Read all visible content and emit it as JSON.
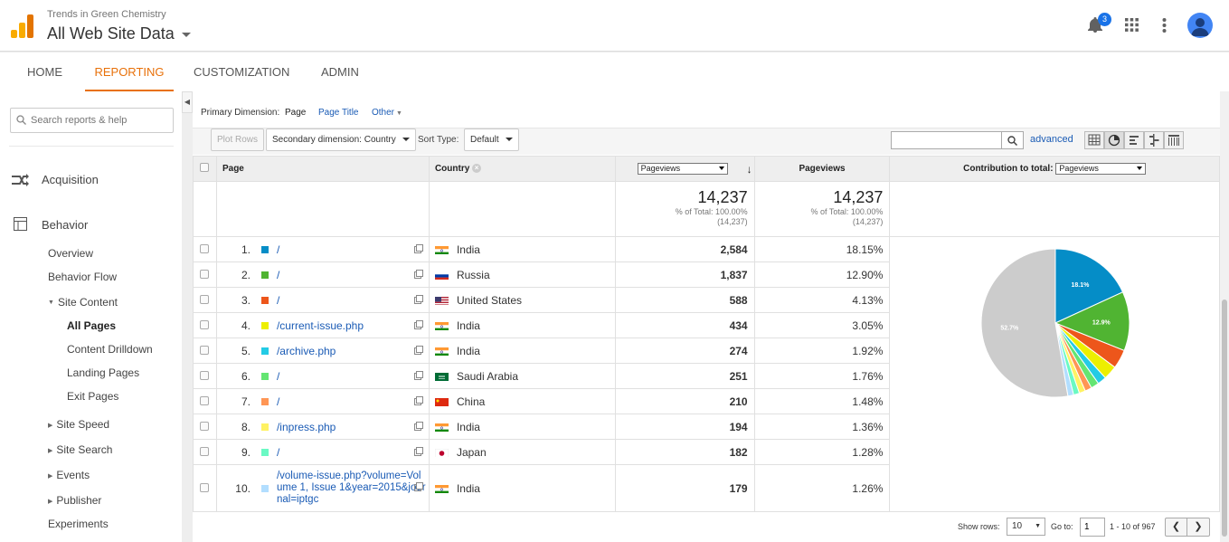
{
  "header": {
    "account_name": "Trends in Green Chemistry",
    "property_name": "All Web Site Data",
    "notification_count": "3"
  },
  "nav": {
    "tabs": [
      "HOME",
      "REPORTING",
      "CUSTOMIZATION",
      "ADMIN"
    ],
    "active_tab": "REPORTING"
  },
  "sidebar": {
    "search_placeholder": "Search reports & help",
    "acquisition": "Acquisition",
    "behavior": "Behavior",
    "overview": "Overview",
    "behavior_flow": "Behavior Flow",
    "site_content": "Site Content",
    "all_pages": "All Pages",
    "content_drilldown": "Content Drilldown",
    "landing_pages": "Landing Pages",
    "exit_pages": "Exit Pages",
    "site_speed": "Site Speed",
    "site_search": "Site Search",
    "events": "Events",
    "publisher": "Publisher",
    "experiments": "Experiments"
  },
  "dimension_bar": {
    "label": "Primary Dimension:",
    "page": "Page",
    "page_title": "Page Title",
    "other": "Other"
  },
  "toolbar": {
    "plot_rows": "Plot Rows",
    "secondary_dimension": "Secondary dimension: Country",
    "sort_type_label": "Sort Type:",
    "sort_type_value": "Default",
    "advanced": "advanced"
  },
  "table": {
    "columns": {
      "page": "Page",
      "country": "Country",
      "metric_select": "Pageviews",
      "pageviews": "Pageviews",
      "contribution_label": "Contribution to total:",
      "contribution_select": "Pageviews"
    },
    "totals": {
      "value1": "14,237",
      "pct1": "% of Total: 100.00%",
      "abs1": "(14,237)",
      "value2": "14,237",
      "pct2": "% of Total: 100.00%",
      "abs2": "(14,237)"
    },
    "rows": [
      {
        "index": "1.",
        "page": "/",
        "country": "India",
        "pageviews": "2,584",
        "percent": "18.15%",
        "color": "#058dc7",
        "flag": "in"
      },
      {
        "index": "2.",
        "page": "/",
        "country": "Russia",
        "pageviews": "1,837",
        "percent": "12.90%",
        "color": "#50b432",
        "flag": "ru"
      },
      {
        "index": "3.",
        "page": "/",
        "country": "United States",
        "pageviews": "588",
        "percent": "4.13%",
        "color": "#ed561b",
        "flag": "us"
      },
      {
        "index": "4.",
        "page": "/current-issue.php",
        "country": "India",
        "pageviews": "434",
        "percent": "3.05%",
        "color": "#edef00",
        "flag": "in"
      },
      {
        "index": "5.",
        "page": "/archive.php",
        "country": "India",
        "pageviews": "274",
        "percent": "1.92%",
        "color": "#24cbe5",
        "flag": "in"
      },
      {
        "index": "6.",
        "page": "/",
        "country": "Saudi Arabia",
        "pageviews": "251",
        "percent": "1.76%",
        "color": "#64e572",
        "flag": "sa"
      },
      {
        "index": "7.",
        "page": "/",
        "country": "China",
        "pageviews": "210",
        "percent": "1.48%",
        "color": "#ff9655",
        "flag": "cn"
      },
      {
        "index": "8.",
        "page": "/inpress.php",
        "country": "India",
        "pageviews": "194",
        "percent": "1.36%",
        "color": "#fff263",
        "flag": "in"
      },
      {
        "index": "9.",
        "page": "/",
        "country": "Japan",
        "pageviews": "182",
        "percent": "1.28%",
        "color": "#6af9c4",
        "flag": "jp"
      },
      {
        "index": "10.",
        "page": "/volume-issue.php?volume=Volume 1, Issue 1&year=2015&journal=iptgc",
        "country": "India",
        "pageviews": "179",
        "percent": "1.26%",
        "color": "#b2deff",
        "flag": "in"
      }
    ]
  },
  "chart_data": {
    "type": "pie",
    "categories": [
      "1",
      "2",
      "3",
      "4",
      "5",
      "6",
      "7",
      "8",
      "9",
      "10",
      "Other"
    ],
    "values": [
      18.15,
      12.9,
      4.13,
      3.05,
      1.92,
      1.76,
      1.48,
      1.36,
      1.28,
      1.26,
      52.71
    ],
    "colors": [
      "#058dc7",
      "#50b432",
      "#ed561b",
      "#edef00",
      "#24cbe5",
      "#64e572",
      "#ff9655",
      "#fff263",
      "#6af9c4",
      "#b2deff",
      "#cccccc"
    ],
    "labels": [
      "18.1%",
      "12.9%",
      "",
      "",
      "",
      "",
      "",
      "",
      "",
      "",
      "52.7%"
    ]
  },
  "footer": {
    "show_rows_label": "Show rows:",
    "show_rows_value": "10",
    "goto_label": "Go to:",
    "goto_value": "1",
    "range": "1 - 10 of 967"
  }
}
